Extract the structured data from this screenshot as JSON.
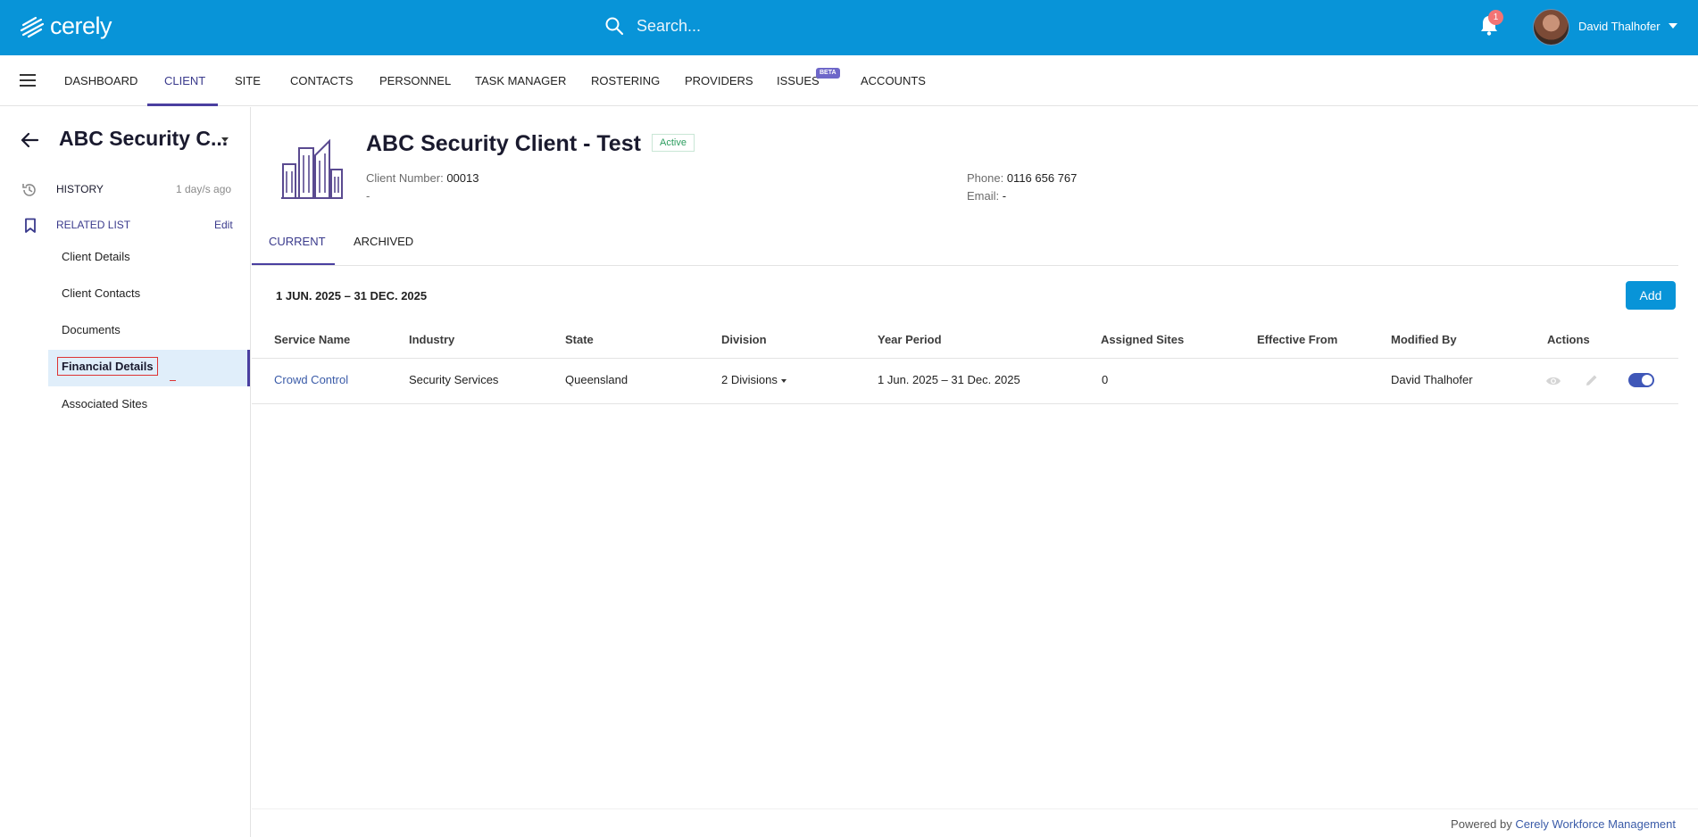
{
  "app": {
    "logo_text": "cerely"
  },
  "search": {
    "placeholder": "Search..."
  },
  "notifications": {
    "count": "1"
  },
  "user": {
    "name": "David Thalhofer"
  },
  "nav": {
    "items": [
      {
        "label": "DASHBOARD"
      },
      {
        "label": "CLIENT"
      },
      {
        "label": "SITE"
      },
      {
        "label": "CONTACTS"
      },
      {
        "label": "PERSONNEL"
      },
      {
        "label": "TASK MANAGER"
      },
      {
        "label": "ROSTERING"
      },
      {
        "label": "PROVIDERS"
      },
      {
        "label": "ISSUES"
      },
      {
        "label": "ACCOUNTS"
      }
    ],
    "beta_label": "BETA",
    "active": "CLIENT"
  },
  "sidebar": {
    "title": "ABC Security C...",
    "history_label": "HISTORY",
    "history_time": "1 day/s ago",
    "related_label": "RELATED LIST",
    "edit_label": "Edit",
    "items": [
      {
        "label": "Client Details"
      },
      {
        "label": "Client Contacts"
      },
      {
        "label": "Documents"
      },
      {
        "label": "Financial Details"
      },
      {
        "label": "Associated Sites"
      }
    ],
    "active_item": "Financial Details"
  },
  "client": {
    "name": "ABC Security Client - Test",
    "status": "Active",
    "number_label": "Client Number:",
    "number": "00013",
    "line2": "-",
    "phone_label": "Phone:",
    "phone": "0116 656 767",
    "email_label": "Email:",
    "email": "-"
  },
  "tabs": [
    {
      "label": "CURRENT"
    },
    {
      "label": "ARCHIVED"
    }
  ],
  "period": "1 JUN. 2025 – 31 DEC. 2025",
  "add_label": "Add",
  "table": {
    "columns": [
      "Service Name",
      "Industry",
      "State",
      "Division",
      "Year Period",
      "Assigned Sites",
      "Effective From",
      "Modified By",
      "Actions"
    ],
    "rows": [
      {
        "service_name": "Crowd Control",
        "industry": "Security Services",
        "state": "Queensland",
        "division": "2 Divisions",
        "year_period": "1 Jun. 2025 – 31 Dec. 2025",
        "assigned_sites": "0",
        "effective_from": "",
        "modified_by": "David Thalhofer",
        "active": true
      }
    ]
  },
  "footer": {
    "prefix": "Powered by",
    "link": "Cerely Workforce Management"
  },
  "colors": {
    "brand": "#0894d8",
    "accent": "#4a3fa0",
    "active_status": "#2d9d5f"
  }
}
